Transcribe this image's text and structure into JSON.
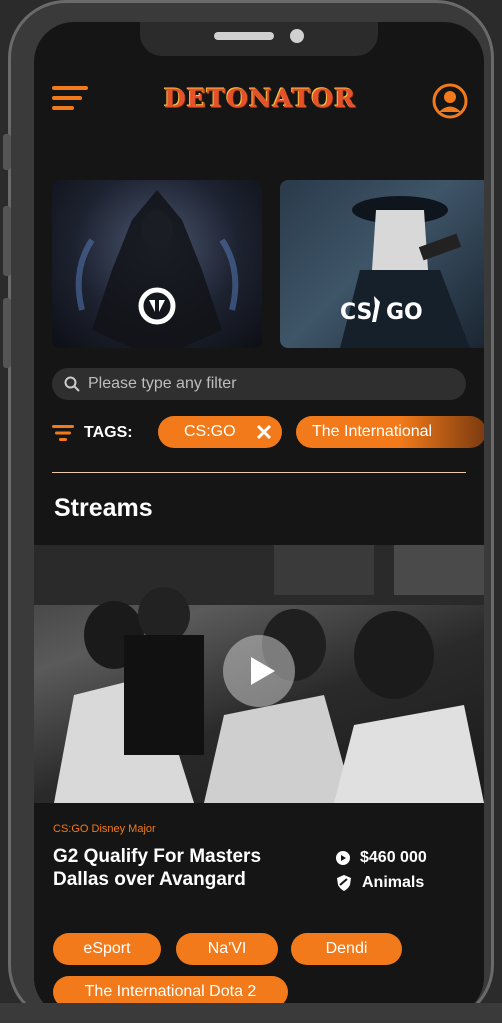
{
  "header": {
    "logo_text": "DETONATOR"
  },
  "games": [
    {
      "name": "Overwatch",
      "logo": "overwatch-logo"
    },
    {
      "name": "CS:GO",
      "logo_text": "CS GO"
    }
  ],
  "search": {
    "placeholder": "Please type any filter"
  },
  "tags": {
    "label": "TAGS:",
    "items": [
      "CS:GO",
      "The International"
    ]
  },
  "section": {
    "title": "Streams"
  },
  "stream": {
    "category": "CS:GO Disney Major",
    "title": "G2 Qualify For Masters Dallas over Avangard",
    "prize": "$460 000",
    "team": "Animals",
    "tags": [
      "eSport",
      "Na'VI",
      "Dendi",
      "The International Dota 2"
    ]
  },
  "colors": {
    "accent": "#f27a1a",
    "background": "#151515"
  }
}
